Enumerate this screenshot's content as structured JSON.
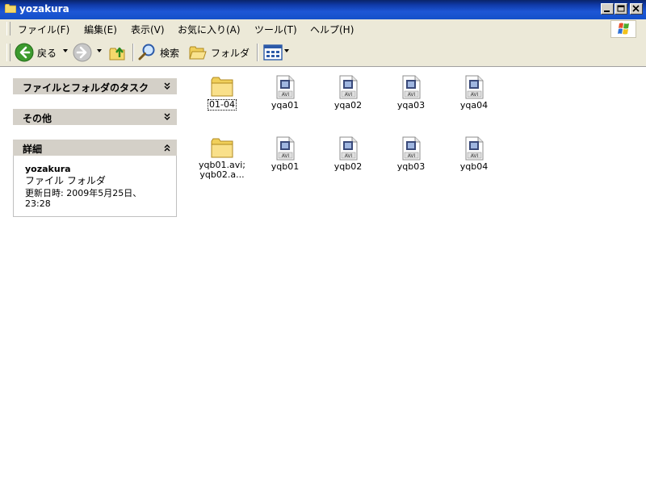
{
  "window": {
    "title": "yozakura"
  },
  "menu": [
    "ファイル(F)",
    "編集(E)",
    "表示(V)",
    "お気に入り(A)",
    "ツール(T)",
    "ヘルプ(H)"
  ],
  "toolbar": {
    "back_label": "戻る",
    "search_label": "検索",
    "folders_label": "フォルダ"
  },
  "tasks": {
    "file_folder_tasks": "ファイルとフォルダのタスク",
    "other": "その他",
    "details": "詳細",
    "details_name": "yozakura",
    "details_type": "ファイル フォルダ",
    "details_modified": "更新日時: 2009年5月25日、23:28"
  },
  "files": [
    {
      "label": "01-04",
      "icon": "folder-icon"
    },
    {
      "label": "yqa01",
      "icon": "avi-file-icon"
    },
    {
      "label": "yqa02",
      "icon": "avi-file-icon"
    },
    {
      "label": "yqa03",
      "icon": "avi-file-icon"
    },
    {
      "label": "yqa04",
      "icon": "avi-file-icon"
    },
    {
      "label": "yqb01.avi; yqb02.a...",
      "icon": "folder-icon"
    },
    {
      "label": "yqb01",
      "icon": "avi-file-icon"
    },
    {
      "label": "yqb02",
      "icon": "avi-file-icon"
    },
    {
      "label": "yqb03",
      "icon": "avi-file-icon"
    },
    {
      "label": "yqb04",
      "icon": "avi-file-icon"
    }
  ],
  "colors": {
    "titlebar": "#0f3aa8",
    "chrome": "#ece9d8",
    "panel_header": "#d4d0c8",
    "back_button": "#3c9a2e"
  }
}
